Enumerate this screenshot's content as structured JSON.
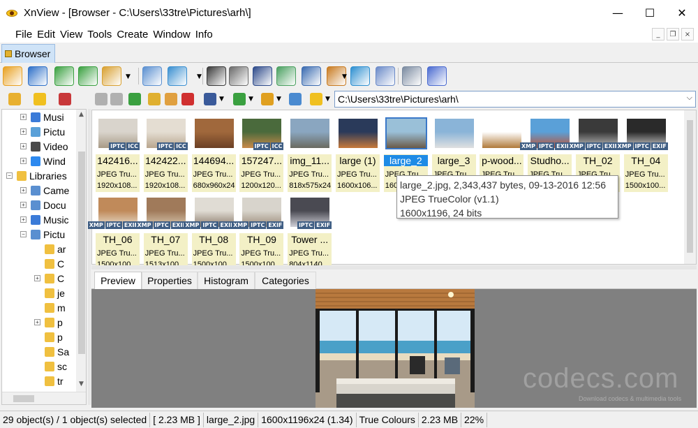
{
  "window": {
    "title": "XnView - [Browser - C:\\Users\\33tre\\Pictures\\arh\\]",
    "minimize": "—",
    "maximize": "☐",
    "close": "✕"
  },
  "menu": [
    "File",
    "Edit",
    "View",
    "Tools",
    "Create",
    "Window",
    "Info"
  ],
  "mdi": {
    "minimize": "_",
    "restore": "❐",
    "close": "×"
  },
  "tab": {
    "label": "Browser"
  },
  "path": {
    "value": "C:\\Users\\33tre\\Pictures\\arh\\"
  },
  "tree": [
    {
      "label": "Musi",
      "indent": 1,
      "expander": "+",
      "icon_color": "#3b7bd8"
    },
    {
      "label": "Pictu",
      "indent": 1,
      "expander": "+",
      "icon_color": "#5aa0d8"
    },
    {
      "label": "Video",
      "indent": 1,
      "expander": "+",
      "icon_color": "#4a4a4a"
    },
    {
      "label": "Wind",
      "indent": 1,
      "expander": "+",
      "icon_color": "#2d89ef"
    },
    {
      "label": "Libraries",
      "indent": 0,
      "expander": "−",
      "icon_color": "#f0c040"
    },
    {
      "label": "Came",
      "indent": 1,
      "expander": "+",
      "icon_color": "#5a8fd0"
    },
    {
      "label": "Docu",
      "indent": 1,
      "expander": "+",
      "icon_color": "#5a8fd0"
    },
    {
      "label": "Music",
      "indent": 1,
      "expander": "+",
      "icon_color": "#3b7bd8"
    },
    {
      "label": "Pictu",
      "indent": 1,
      "expander": "−",
      "icon_color": "#5a8fd0"
    },
    {
      "label": "ar",
      "indent": 2,
      "expander": "",
      "icon_color": "#f0c040"
    },
    {
      "label": "C",
      "indent": 2,
      "expander": "",
      "icon_color": "#f0c040"
    },
    {
      "label": "C",
      "indent": 2,
      "expander": "+",
      "icon_color": "#f0c040"
    },
    {
      "label": "je",
      "indent": 2,
      "expander": "",
      "icon_color": "#f0c040"
    },
    {
      "label": "m",
      "indent": 2,
      "expander": "",
      "icon_color": "#f0c040"
    },
    {
      "label": "p",
      "indent": 2,
      "expander": "+",
      "icon_color": "#f0c040"
    },
    {
      "label": "p",
      "indent": 2,
      "expander": "",
      "icon_color": "#f0c040"
    },
    {
      "label": "Sa",
      "indent": 2,
      "expander": "",
      "icon_color": "#f0c040"
    },
    {
      "label": "sc",
      "indent": 2,
      "expander": "",
      "icon_color": "#f0c040"
    },
    {
      "label": "tr",
      "indent": 2,
      "expander": "",
      "icon_color": "#f0c040"
    }
  ],
  "thumbnails": [
    {
      "name": "142416...",
      "format": "JPEG Tru...",
      "dims": "1920x108...",
      "tags": [
        "IPTC",
        "ICC"
      ],
      "colors": [
        "#d9d4cc",
        "#a89a86"
      ]
    },
    {
      "name": "142422...",
      "format": "JPEG Tru...",
      "dims": "1920x108...",
      "tags": [
        "IPTC",
        "ICC"
      ],
      "colors": [
        "#e4ddd2",
        "#b9a68e"
      ]
    },
    {
      "name": "144694...",
      "format": "JPEG Tru...",
      "dims": "680x960x24",
      "tags": [],
      "colors": [
        "#a0683c",
        "#6b4024"
      ]
    },
    {
      "name": "157247...",
      "format": "JPEG Tru...",
      "dims": "1200x120...",
      "tags": [
        "IPTC",
        "ICC"
      ],
      "colors": [
        "#4a6a3c",
        "#c88a4a"
      ]
    },
    {
      "name": "img_11...",
      "format": "JPEG Tru...",
      "dims": "818x575x24",
      "tags": [],
      "colors": [
        "#8aa6c0",
        "#6a6a60"
      ]
    },
    {
      "name": "large (1)",
      "format": "JPEG Tru...",
      "dims": "1600x106...",
      "tags": [],
      "colors": [
        "#2a3a5a",
        "#c87a3a"
      ]
    },
    {
      "name": "large_2",
      "format": "JPEG Tru...",
      "dims": "160",
      "tags": [],
      "colors": [
        "#9ac0d8",
        "#6a5a48"
      ],
      "selected": true
    },
    {
      "name": "large_3",
      "format": "JPEG Tru...",
      "dims": "",
      "tags": [],
      "colors": [
        "#8ab4d8",
        "#e0e0e0"
      ]
    },
    {
      "name": "p-wood...",
      "format": "JPEG Tru...",
      "dims": "",
      "tags": [],
      "colors": [
        "#ffffff",
        "#b07a3a"
      ]
    },
    {
      "name": "Studho...",
      "format": "JPEG Tru...",
      "dims": "",
      "tags": [
        "XMP",
        "IPTC",
        "EXIF"
      ],
      "colors": [
        "#5aa0d8",
        "#c05030"
      ]
    },
    {
      "name": "TH_02",
      "format": "JPEG Tru...",
      "dims": "",
      "tags": [
        "XMP",
        "IPTC",
        "EXIF"
      ],
      "colors": [
        "#3a3a3a",
        "#c0c0c0"
      ]
    },
    {
      "name": "TH_04",
      "format": "JPEG Tru...",
      "dims": "1500x100...",
      "tags": [
        "XMP",
        "IPTC",
        "EXIF"
      ],
      "colors": [
        "#2a2a2a",
        "#d0d0d0"
      ]
    },
    {
      "name": "TH_06",
      "format": "JPEG Tru...",
      "dims": "1500x100...",
      "tags": [
        "XMP",
        "IPTC",
        "EXIF"
      ],
      "colors": [
        "#c08a5a",
        "#e8e0d0"
      ]
    },
    {
      "name": "TH_07",
      "format": "JPEG Tru...",
      "dims": "1513x100...",
      "tags": [
        "XMP",
        "IPTC",
        "EXIF"
      ],
      "colors": [
        "#a07a5a",
        "#d8c8b0"
      ]
    },
    {
      "name": "TH_08",
      "format": "JPEG Tru...",
      "dims": "1500x100...",
      "tags": [
        "XMP",
        "IPTC",
        "EXIF"
      ],
      "colors": [
        "#e0dcd4",
        "#8a7a6a"
      ]
    },
    {
      "name": "TH_09",
      "format": "JPEG Tru...",
      "dims": "1500x100...",
      "tags": [
        "XMP",
        "IPTC",
        "EXIF"
      ],
      "colors": [
        "#d8d4cc",
        "#9a8a78"
      ]
    },
    {
      "name": "Tower ...",
      "format": "JPEG Tru...",
      "dims": "804x1140...",
      "tags": [
        "IPTC",
        "EXIF"
      ],
      "colors": [
        "#4a4a52",
        "#d0d0d8"
      ]
    }
  ],
  "tooltip": {
    "line1": "large_2.jpg, 2,343,437 bytes, 09-13-2016 12:56",
    "line2": "JPEG TrueColor (v1.1)",
    "line3": "1600x1196, 24 bits"
  },
  "preview_tabs": [
    "Preview",
    "Properties",
    "Histogram",
    "Categories"
  ],
  "watermark": {
    "main": "codecs.com",
    "sub": "Download codecs & multimedia tools"
  },
  "status": [
    "29 object(s) / 1 object(s) selected",
    "[ 2.23 MB ]",
    "large_2.jpg",
    "1600x1196x24 (1.34)",
    "True Colours",
    "2.23 MB",
    "22%"
  ],
  "toolbar_icons": [
    {
      "name": "fullscreen-icon",
      "color": "#e8a020"
    },
    {
      "name": "slideshow-icon",
      "color": "#2d6fc8"
    },
    {
      "name": "rotate-left-icon",
      "color": "#3aa040"
    },
    {
      "name": "rotate-right-icon",
      "color": "#3aa040"
    },
    {
      "name": "convert-icon",
      "color": "#d8a030"
    },
    {
      "name": "info-icon",
      "color": "#5a8fd0"
    },
    {
      "name": "export-icon",
      "color": "#3a8fd0"
    },
    {
      "name": "search-icon",
      "color": "#3a3a3a"
    },
    {
      "name": "print-icon",
      "color": "#6a6a6a"
    },
    {
      "name": "scanner-icon",
      "color": "#2d4a8a"
    },
    {
      "name": "capture-icon",
      "color": "#4aa060"
    },
    {
      "name": "camera-icon",
      "color": "#3a6ab0"
    },
    {
      "name": "webpage-icon",
      "color": "#c87a20"
    },
    {
      "name": "globe-icon",
      "color": "#2d8fd0"
    },
    {
      "name": "grid-icon",
      "color": "#6a8ac8"
    },
    {
      "name": "settings-icon",
      "color": "#7a8aa0"
    },
    {
      "name": "help-icon",
      "color": "#4a6ad0"
    }
  ],
  "toolbar2_icons": [
    {
      "name": "back-icon",
      "color": "#b0b0b0"
    },
    {
      "name": "forward-icon",
      "color": "#b0b0b0"
    },
    {
      "name": "up-folder-icon",
      "color": "#3aa040"
    },
    {
      "name": "new-folder-icon",
      "color": "#e0b030"
    },
    {
      "name": "edit-icon",
      "color": "#e0a040"
    },
    {
      "name": "delete-icon",
      "color": "#d03030"
    },
    {
      "name": "view-mode-icon",
      "color": "#3a5a9a"
    },
    {
      "name": "sort-icon",
      "color": "#3aa040"
    },
    {
      "name": "filter-icon",
      "color": "#e0a020"
    },
    {
      "name": "refresh-icon",
      "color": "#4a8ad0"
    },
    {
      "name": "favorite-icon",
      "color": "#f0c020"
    }
  ]
}
